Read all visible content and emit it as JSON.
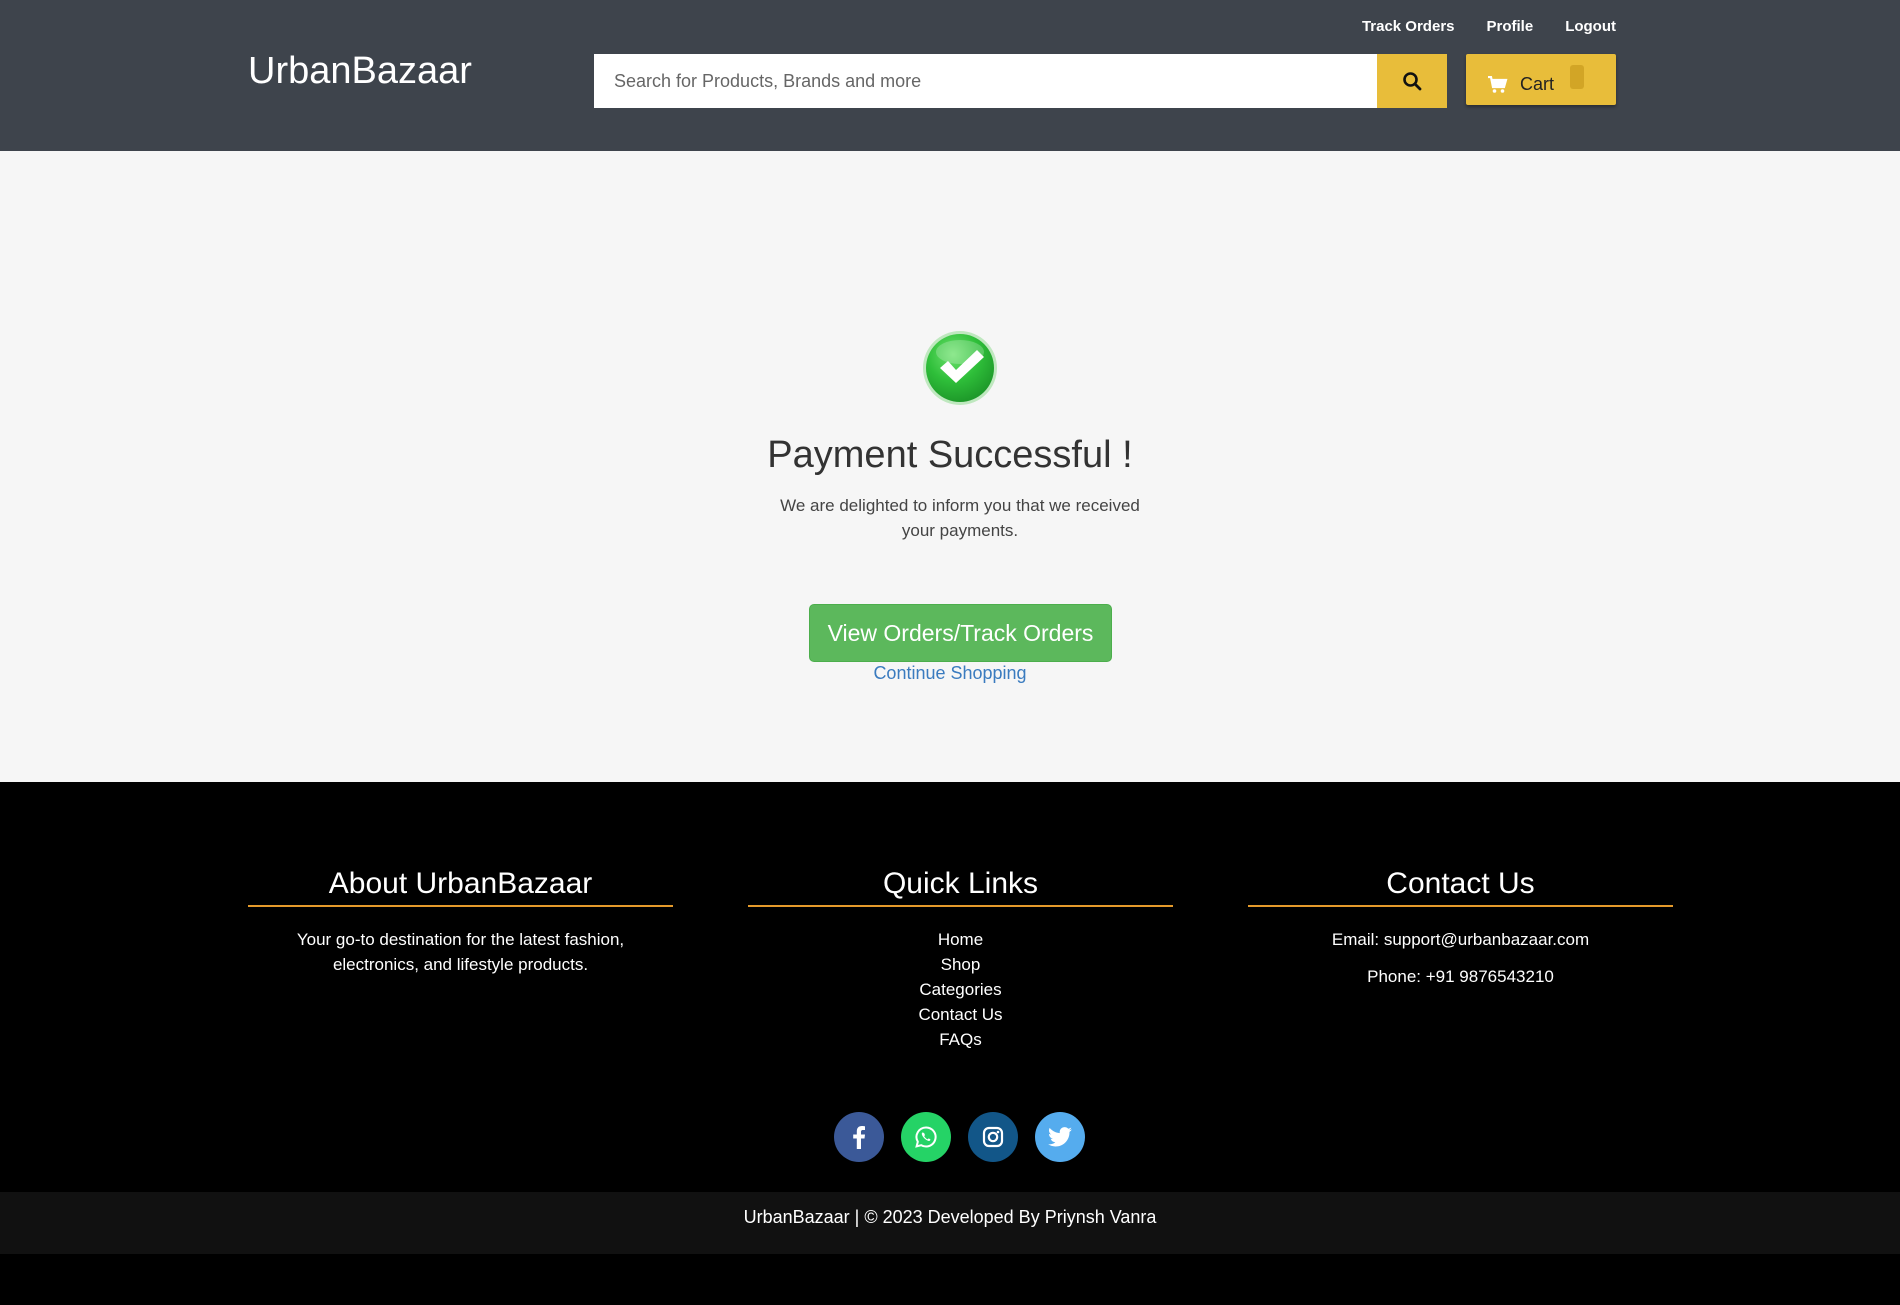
{
  "header": {
    "brand": "UrbanBazaar",
    "links": [
      "Track Orders",
      "Profile",
      "Logout"
    ],
    "search_placeholder": "Search for Products, Brands and more",
    "cart_label": "Cart"
  },
  "main": {
    "title": "Payment Successful !",
    "description": "We are delighted to inform you that we received your payments.",
    "view_orders_label": "View Orders/Track Orders",
    "continue_label": "Continue Shopping"
  },
  "footer": {
    "about": {
      "heading": "About UrbanBazaar",
      "text": "Your go-to destination for the latest fashion, electronics, and lifestyle products."
    },
    "quick_links": {
      "heading": "Quick Links",
      "items": [
        "Home",
        "Shop",
        "Categories",
        "Contact Us",
        "FAQs"
      ]
    },
    "contact": {
      "heading": "Contact Us",
      "email": "Email: support@urbanbazaar.com",
      "phone": "Phone: +91 9876543210"
    },
    "socials": [
      "facebook-icon",
      "whatsapp-icon",
      "instagram-icon",
      "twitter-icon"
    ],
    "copyright": "UrbanBazaar | © 2023 Developed By Priynsh Vanra"
  },
  "colors": {
    "header_bg": "#3e444c",
    "accent_yellow": "#e8bd3a",
    "success_green": "#5cb85c",
    "link_blue": "#3a7bbf",
    "footer_underline": "#e49a2b"
  }
}
